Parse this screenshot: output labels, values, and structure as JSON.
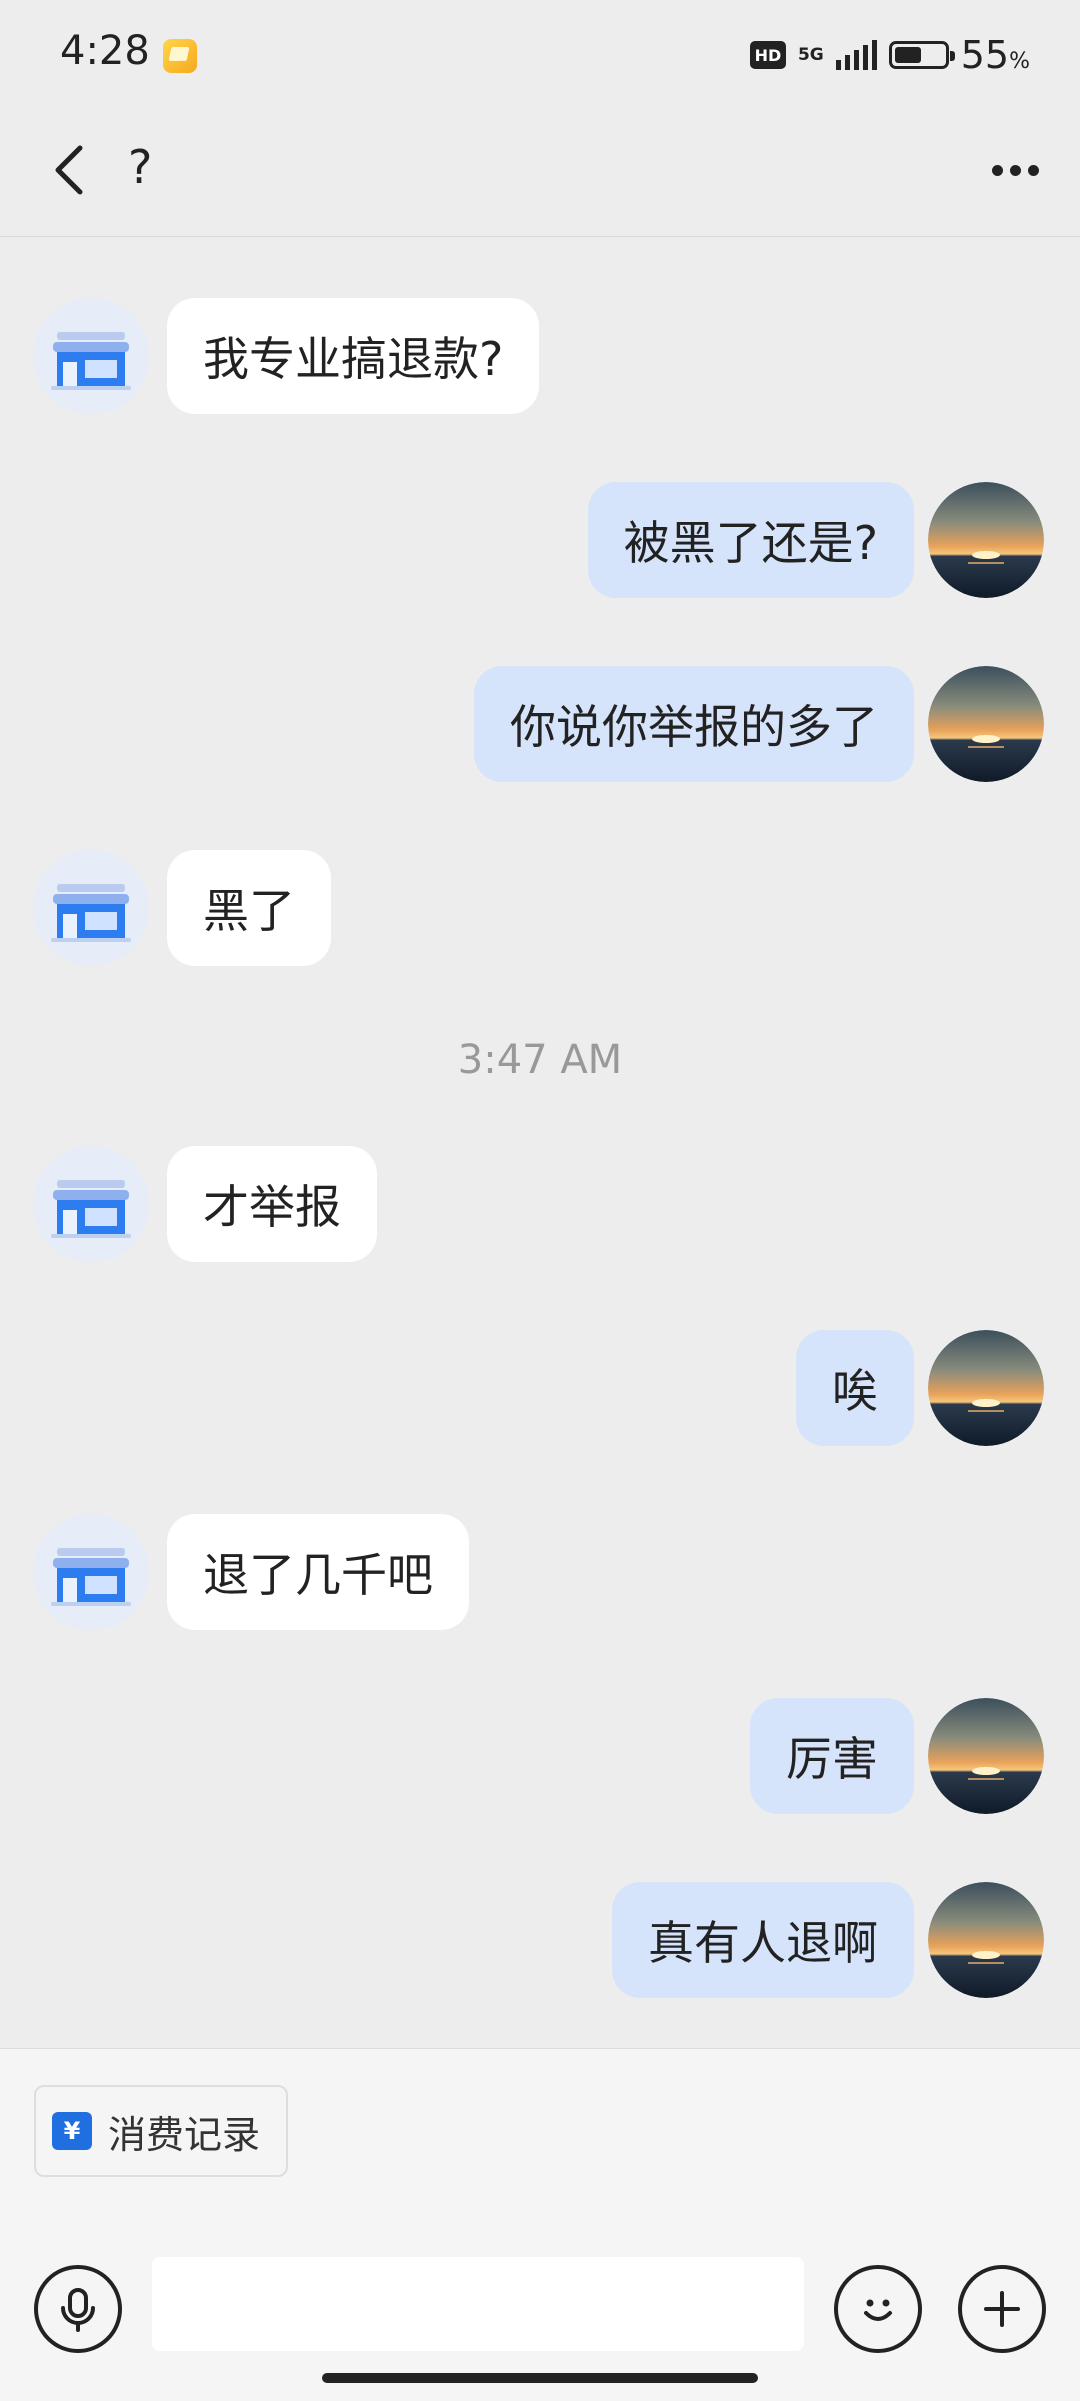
{
  "status_bar": {
    "time": "4:28",
    "hd_badge": "HD",
    "network": "5G",
    "battery_percent": "55",
    "battery_unit": "%",
    "battery_level": 0.55,
    "app_icon": "gallery-icon"
  },
  "header": {
    "title": "?",
    "back_icon": "chevron-left-icon",
    "more_icon": "more-horizontal-icon"
  },
  "messages": [
    {
      "side": "in",
      "text": "我专业搞退款?",
      "avatar": "store-icon"
    },
    {
      "side": "out",
      "text": "被黑了还是?",
      "avatar": "sunset-avatar"
    },
    {
      "side": "out",
      "text": "你说你举报的多了",
      "avatar": "sunset-avatar"
    },
    {
      "side": "in",
      "text": "黑了",
      "avatar": "store-icon"
    },
    {
      "side": "divider",
      "text": "3:47 AM"
    },
    {
      "side": "in",
      "text": "才举报",
      "avatar": "store-icon"
    },
    {
      "side": "out",
      "text": "唉",
      "avatar": "sunset-avatar"
    },
    {
      "side": "in",
      "text": "退了几千吧",
      "avatar": "store-icon"
    },
    {
      "side": "out",
      "text": "厉害",
      "avatar": "sunset-avatar"
    },
    {
      "side": "out",
      "text": "真有人退啊",
      "avatar": "sunset-avatar"
    }
  ],
  "bottom": {
    "chip_label": "消费记录",
    "chip_icon_glyph": "¥",
    "input_value": "",
    "voice_icon": "microphone-icon",
    "emoji_icon": "smiley-icon",
    "plus_icon": "plus-icon"
  },
  "colors": {
    "background": "#ededed",
    "incoming_bubble": "#ffffff",
    "outgoing_bubble": "#d6e4fb",
    "accent": "#1f6fe0"
  }
}
